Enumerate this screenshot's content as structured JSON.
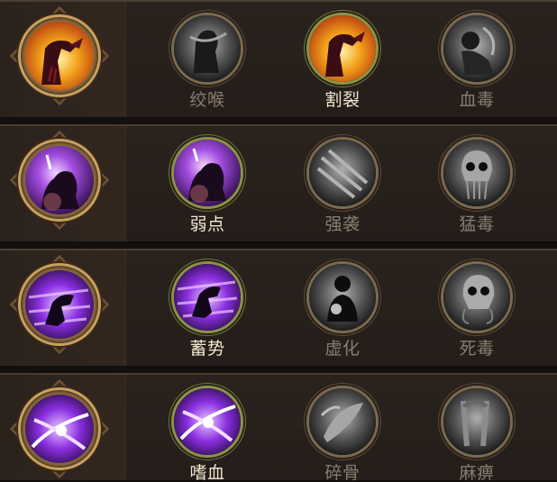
{
  "rows": [
    {
      "main_icon": "bleed-strike-icon",
      "skills": [
        {
          "label": "绞喉",
          "icon": "garrote-icon",
          "active": false
        },
        {
          "label": "割裂",
          "icon": "rupture-icon",
          "active": true
        },
        {
          "label": "血毒",
          "icon": "blood-poison-icon",
          "active": false
        }
      ]
    },
    {
      "main_icon": "weakpoint-icon",
      "skills": [
        {
          "label": "弱点",
          "icon": "weakpoint-icon",
          "active": true
        },
        {
          "label": "强袭",
          "icon": "assault-icon",
          "active": false
        },
        {
          "label": "猛毒",
          "icon": "venom-skull-icon",
          "active": false
        }
      ]
    },
    {
      "main_icon": "momentum-icon",
      "skills": [
        {
          "label": "蓄势",
          "icon": "momentum-icon",
          "active": true
        },
        {
          "label": "虚化",
          "icon": "vanish-icon",
          "active": false
        },
        {
          "label": "死毒",
          "icon": "death-poison-icon",
          "active": false
        }
      ]
    },
    {
      "main_icon": "bloodlust-slash-icon",
      "skills": [
        {
          "label": "嗜血",
          "icon": "bloodlust-slash-icon",
          "active": true
        },
        {
          "label": "碎骨",
          "icon": "bone-crush-icon",
          "active": false
        },
        {
          "label": "麻痹",
          "icon": "paralyze-icon",
          "active": false
        }
      ]
    }
  ],
  "colors": {
    "active_label": "#f2e6cf",
    "inactive_label": "#8a7d70",
    "active_ring": "#8a9447",
    "gold_frame": "#c9a062"
  }
}
